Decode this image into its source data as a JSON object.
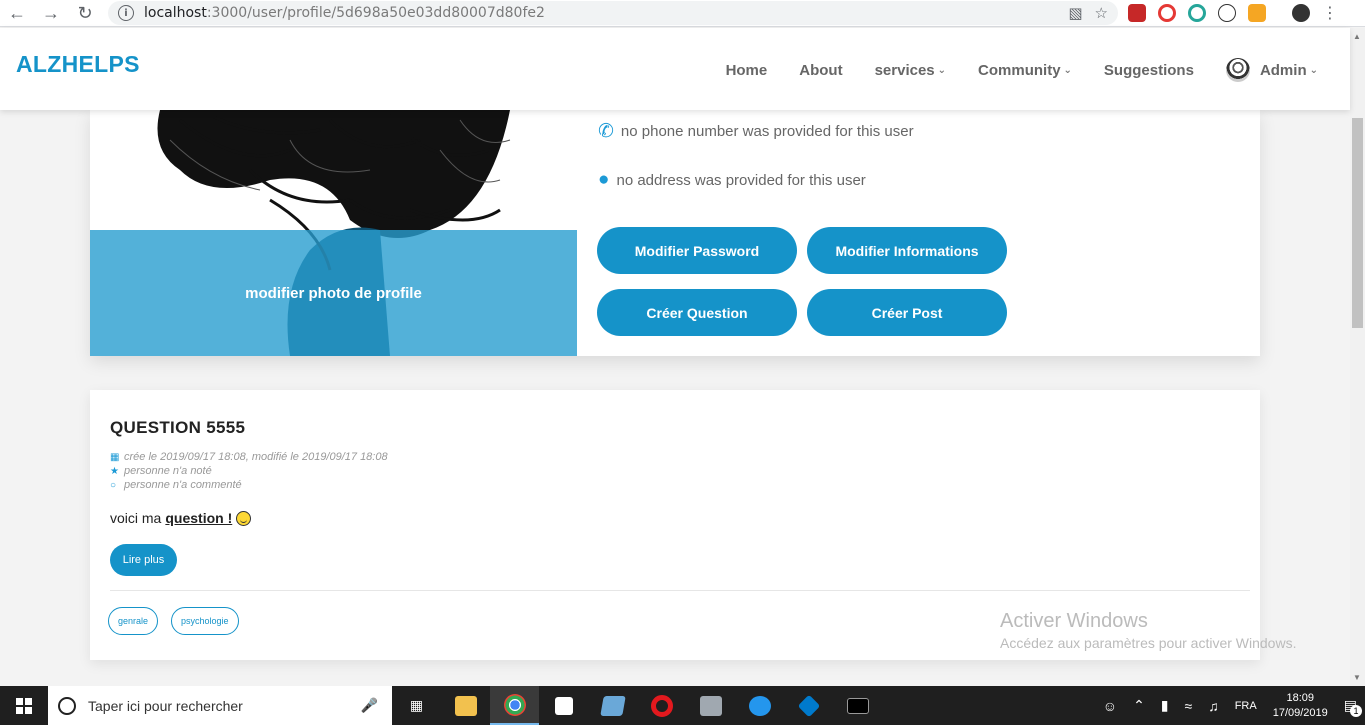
{
  "browser": {
    "url_host": "localhost",
    "url_path": ":3000/user/profile/5d698a50e03dd80007d80fe2"
  },
  "header": {
    "brand": "ALZHELPS",
    "nav": {
      "home": "Home",
      "about": "About",
      "services": "services",
      "community": "Community",
      "suggestions": "Suggestions",
      "user": "Admin"
    }
  },
  "profile": {
    "photo_overlay": "modifier photo de profile",
    "phone": "no phone number was provided for this user",
    "address": "no address was provided for this user",
    "buttons": {
      "modify_password": "Modifier Password",
      "modify_info": "Modifier Informations",
      "create_question": "Créer Question",
      "create_post": "Créer Post"
    }
  },
  "question": {
    "title": "QUESTION 5555",
    "created": "crée le 2019/09/17 18:08, modifié le 2019/09/17 18:08",
    "rating": "personne n'a noté",
    "comments": "personne n'a commenté",
    "body_prefix": "voici ma",
    "body_emphasis": "question !",
    "read_more": "Lire plus",
    "tags": [
      "genrale",
      "psychologie"
    ]
  },
  "watermark": {
    "title": "Activer Windows",
    "subtitle": "Accédez aux paramètres pour activer Windows."
  },
  "taskbar": {
    "search_placeholder": "Taper ici pour rechercher",
    "language": "FRA",
    "time": "18:09",
    "date": "17/09/2019",
    "notification_count": "1"
  },
  "colors": {
    "accent": "#1593c9",
    "overlay": "#289dd0"
  }
}
